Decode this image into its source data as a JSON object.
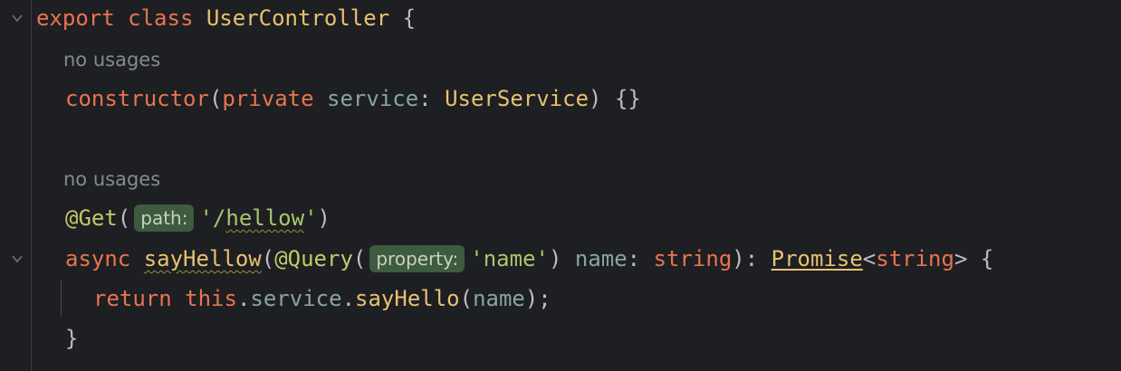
{
  "code": {
    "line1": {
      "export": "export",
      "class": "class",
      "name": "UserController",
      "brace": "{"
    },
    "hint1": "no usages",
    "line2": {
      "constructor": "constructor",
      "open": "(",
      "private": "private",
      "service": "service",
      "colon": ":",
      "type": "UserService",
      "close": ")",
      "body": "{}"
    },
    "hint2": "no usages",
    "line3": {
      "decorator": "@Get",
      "open": "(",
      "inlay": "path:",
      "quote_open": "'/",
      "path": "hellow",
      "quote_close": "'",
      "close": ")"
    },
    "line4": {
      "async": "async",
      "fn_name": "sayHellow",
      "open": "(",
      "decorator": "@Query",
      "dec_open": "(",
      "inlay": "property:",
      "arg": "'name'",
      "dec_close": ")",
      "param": "name",
      "colon": ":",
      "param_type": "string",
      "close": "):",
      "promise": "Promise",
      "lt": "<",
      "generic": "string",
      "gt": ">",
      "brace": "{"
    },
    "line5": {
      "return": "return",
      "this": "this",
      "dot1": ".",
      "service": "service",
      "dot2": ".",
      "method": "sayHello",
      "open": "(",
      "arg": "name",
      "close": ");"
    },
    "line6": {
      "brace": "}"
    }
  }
}
